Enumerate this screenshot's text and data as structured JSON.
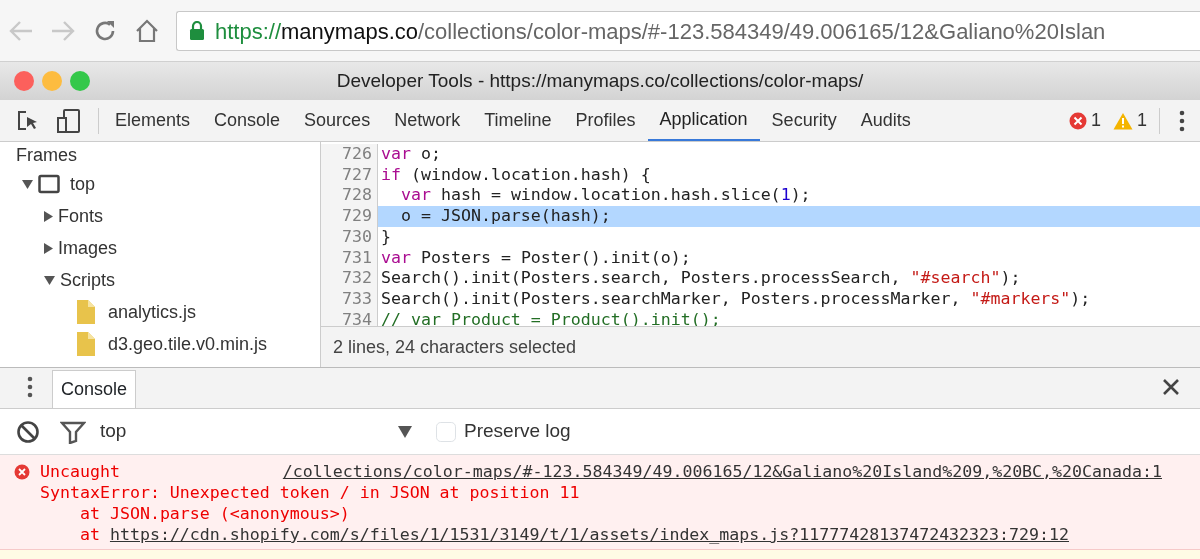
{
  "browser": {
    "url": {
      "scheme": "https://",
      "host": "manymaps.co",
      "path": "/collections/color-maps/#-123.584349/49.006165/12&Galiano%20Islan"
    },
    "secure": true
  },
  "window": {
    "title": "Developer Tools - https://manymaps.co/collections/color-maps/"
  },
  "tabs": [
    {
      "label": "Elements",
      "selected": false
    },
    {
      "label": "Console",
      "selected": false
    },
    {
      "label": "Sources",
      "selected": false
    },
    {
      "label": "Network",
      "selected": false
    },
    {
      "label": "Timeline",
      "selected": false
    },
    {
      "label": "Profiles",
      "selected": false
    },
    {
      "label": "Application",
      "selected": true
    },
    {
      "label": "Security",
      "selected": false
    },
    {
      "label": "Audits",
      "selected": false
    }
  ],
  "counts": {
    "errors": "1",
    "warnings": "1"
  },
  "sidebar": {
    "heading": "Frames",
    "items": [
      {
        "label": "top",
        "kind": "frame",
        "expanded": true,
        "children": [
          {
            "label": "Fonts",
            "kind": "folder",
            "expanded": false
          },
          {
            "label": "Images",
            "kind": "folder",
            "expanded": false
          },
          {
            "label": "Scripts",
            "kind": "folder",
            "expanded": true,
            "children": [
              {
                "label": "analytics.js",
                "kind": "file"
              },
              {
                "label": "d3.geo.tile.v0.min.js",
                "kind": "file"
              }
            ]
          }
        ]
      }
    ]
  },
  "code": {
    "lines": [
      {
        "number": "726",
        "selected": false,
        "tokens": [
          {
            "kind": "keyword",
            "text": "var"
          },
          {
            "kind": "plain",
            "text": " o;"
          }
        ]
      },
      {
        "number": "727",
        "selected": false,
        "tokens": [
          {
            "kind": "keyword",
            "text": "if"
          },
          {
            "kind": "plain",
            "text": " (window.location.hash) {"
          }
        ]
      },
      {
        "number": "728",
        "selected": false,
        "tokens": [
          {
            "kind": "keyword",
            "text": "  var"
          },
          {
            "kind": "plain",
            "text": " hash = window.location.hash.slice("
          },
          {
            "kind": "number",
            "text": "1"
          },
          {
            "kind": "plain",
            "text": ");"
          }
        ]
      },
      {
        "number": "729",
        "selected": true,
        "tokens": [
          {
            "kind": "plain",
            "text": "  o = JSON.parse(hash);"
          }
        ]
      },
      {
        "number": "730",
        "selected": false,
        "tokens": [
          {
            "kind": "plain",
            "text": "}"
          }
        ]
      },
      {
        "number": "731",
        "selected": false,
        "tokens": [
          {
            "kind": "keyword",
            "text": "var"
          },
          {
            "kind": "plain",
            "text": " Posters = Poster().init(o);"
          }
        ]
      },
      {
        "number": "732",
        "selected": false,
        "tokens": [
          {
            "kind": "plain",
            "text": "Search().init(Posters.search, Posters.processSearch, "
          },
          {
            "kind": "string",
            "text": "\"#search\""
          },
          {
            "kind": "plain",
            "text": ");"
          }
        ]
      },
      {
        "number": "733",
        "selected": false,
        "tokens": [
          {
            "kind": "plain",
            "text": "Search().init(Posters.searchMarker, Posters.processMarker, "
          },
          {
            "kind": "string",
            "text": "\"#markers\""
          },
          {
            "kind": "plain",
            "text": ");"
          }
        ]
      },
      {
        "number": "734",
        "selected": false,
        "tokens": [
          {
            "kind": "comment",
            "text": "// var Product = Product().init();"
          }
        ]
      }
    ],
    "status": "2 lines, 24 characters selected"
  },
  "drawer": {
    "tab": "Console",
    "context": "top",
    "preserve_log": false,
    "preserve_label": "Preserve log"
  },
  "messages": [
    {
      "kind": "error",
      "text": "Uncaught",
      "source": "/collections/color-maps/#-123.584349/49.006165/12&Galiano%20Island%209,%20BC,%20Canada:1",
      "lines": [
        {
          "text": "SyntaxError: Unexpected token / in JSON at position 11"
        },
        {
          "text": "    at JSON.parse (<anonymous>)"
        },
        {
          "text": "    at ",
          "link": "https://cdn.shopify.com/s/files/1/1531/3149/t/1/assets/index_maps.js?11777428137472432323:729:12"
        }
      ]
    }
  ]
}
